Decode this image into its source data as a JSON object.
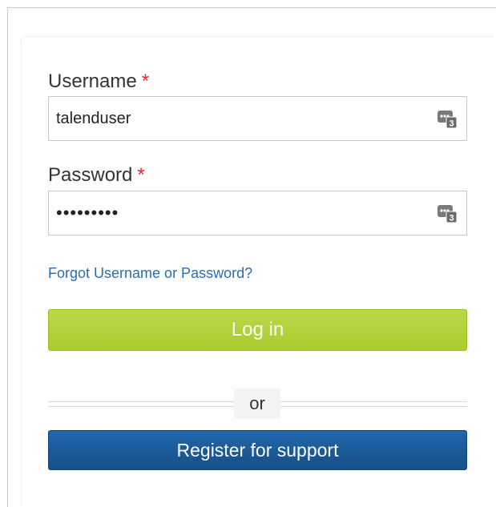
{
  "form": {
    "username_label": "Username",
    "username_required": "*",
    "username_value": "talenduser",
    "password_label": "Password",
    "password_required": "*",
    "password_value": "talendpwd",
    "forgot_link": "Forgot Username or Password?",
    "login_button": "Log in",
    "divider_text": "or",
    "register_button": "Register for support"
  },
  "icons": {
    "field_icon": "password-manager-icon"
  },
  "colors": {
    "login_button": "#a9cc2d",
    "register_button": "#1a5a98",
    "link": "#2a6db3",
    "required": "#e0282e"
  }
}
